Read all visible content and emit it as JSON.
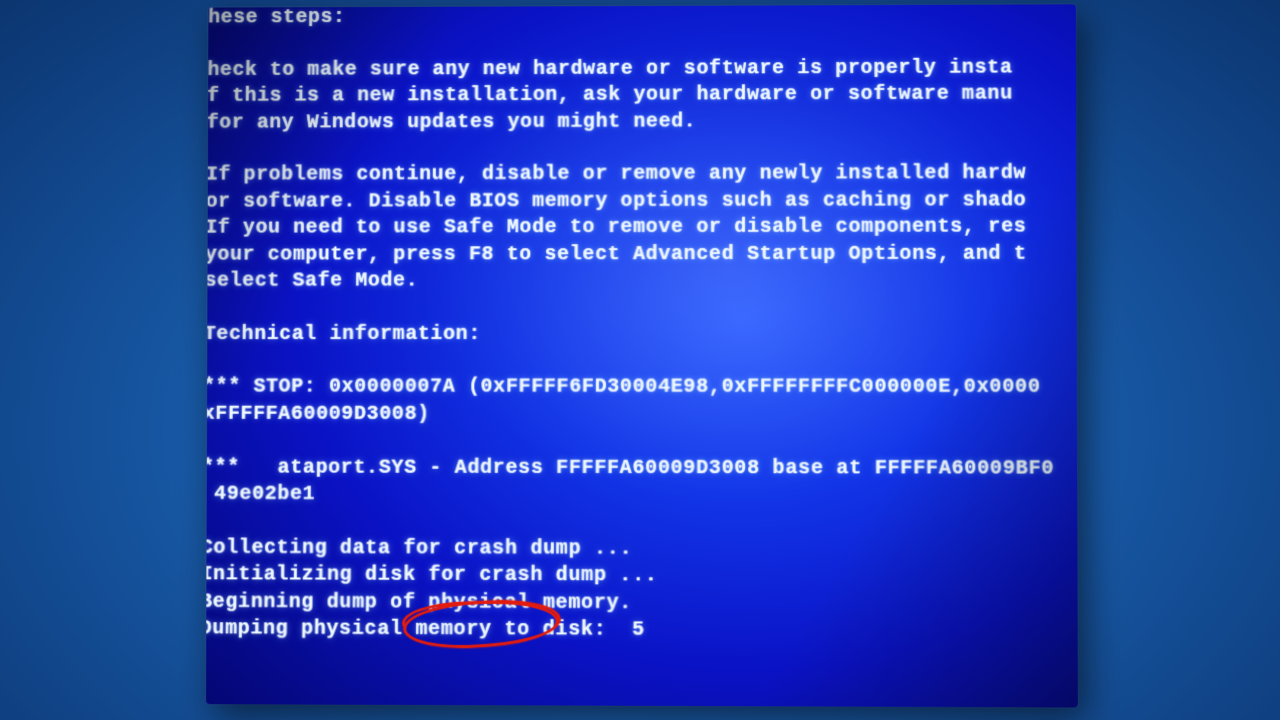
{
  "bsod": {
    "line_steps_tail": "hese steps:",
    "para1_l1": "heck to make sure any new hardware or software is properly insta",
    "para1_l2": "f this is a new installation, ask your hardware or software manu",
    "para1_l3": "for any Windows updates you might need.",
    "para2_l1": "If problems continue, disable or remove any newly installed hardw",
    "para2_l2": "or software. Disable BIOS memory options such as caching or shado",
    "para2_l3": "If you need to use Safe Mode to remove or disable components, res",
    "para2_l4": "your computer, press F8 to select Advanced Startup Options, and t",
    "para2_l5": "select Safe Mode.",
    "tech_header": "Technical information:",
    "stop_l1": "*** STOP: 0x0000007A (0xFFFFF6FD30004E98,0xFFFFFFFFC000000E,0x0000",
    "stop_l2": "xFFFFFA60009D3008)",
    "driver_l1": "***   ataport.SYS - Address FFFFFA60009D3008 base at FFFFFA60009BF0",
    "driver_l2": " 49e02be1",
    "dump_l1_a": "Collecting data for ",
    "dump_l1_hl": "crash dump",
    "dump_l1_b": " ...",
    "dump_l2": "Initializing disk for crash dump ...",
    "dump_l3": "Beginning dump of physical memory.",
    "dump_l4": "Dumping physical memory to disk:  5",
    "annotation_target": "crash dump"
  }
}
